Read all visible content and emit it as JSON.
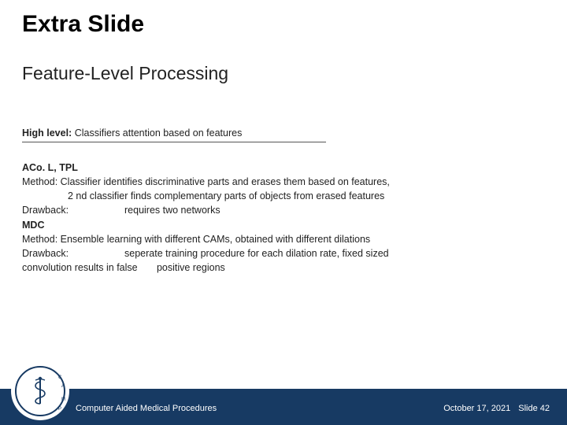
{
  "title": "Extra Slide",
  "subtitle": "Feature-Level Processing",
  "highlevel_label": "High level:",
  "highlevel_text": " Classifiers attention based on features",
  "sec1_name": "ACo. L, TPL",
  "sec1_method_label": "Method:  ",
  "sec1_method_text": "Classifier identifies discriminative parts and erases them based on features,",
  "sec1_method_cont": "2 nd classifier finds complementary parts of objects from erased features",
  "sec1_drawback_label": "Drawback:",
  "sec1_drawback_text": "requires two networks",
  "sec2_name": "MDC",
  "sec2_method_label": "Method:  ",
  "sec2_method_text": "Ensemble learning with different CAMs, obtained with different dilations",
  "sec2_drawback_label": "Drawback:",
  "sec2_drawback_text": "seperate training procedure for each dilation rate, fixed sized",
  "sec2_drawback_cont1": "convolution results in false ",
  "sec2_drawback_cont2": "positive regions",
  "footer_left": "Computer Aided Medical Procedures",
  "footer_date": "October 17, 2021",
  "footer_slide": "Slide 42",
  "logo_letters": "CAMP"
}
